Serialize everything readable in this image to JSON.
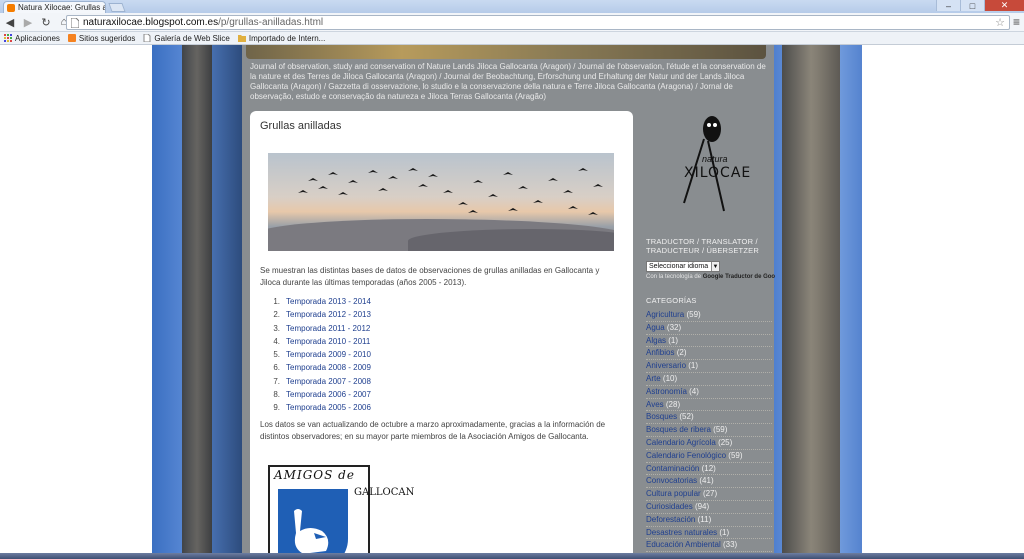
{
  "browser": {
    "tab_title": "Natura Xilocae: Grullas an",
    "tab_close": "×",
    "url_host": "naturaxilocae.blogspot.com.es",
    "url_path": "/p/grullas-anilladas.html",
    "window_controls": [
      "–",
      "□",
      "✕"
    ]
  },
  "bookmarks": [
    {
      "label": "Aplicaciones",
      "icon": "apps-grid-icon",
      "color": "#d44"
    },
    {
      "label": "Sitios sugeridos",
      "icon": "orange-square-icon",
      "color": "#f58220"
    },
    {
      "label": "Galería de Web Slice",
      "icon": "page-icon",
      "color": "#888"
    },
    {
      "label": "Importado de Intern...",
      "icon": "folder-icon",
      "color": "#e0b040"
    }
  ],
  "blog": {
    "description": "Journal of observation, study and conservation of Nature Lands Jiloca Gallocanta (Aragon) / Journal de l'observation, l'étude et la conservation de la nature et des Terres de Jiloca Gallocanta (Aragon) / Journal der Beobachtung, Erforschung und Erhaltung der Natur und der Lands Jiloca Gallocanta (Aragon) / Gazzetta di osservazione, lo studio e la conservazione della natura e Terre Jiloca Gallocanta (Aragona) / Jornal de observação, estudo e conservação da natureza e Jiloca Terras Gallocanta (Aragão)",
    "post_title": "Grullas anilladas",
    "intro": "Se muestran las distintas bases de datos de observaciones de grullas anilladas en Gallocanta y Jiloca durante las últimas temporadas (años 2005 - 2013).",
    "seasons": [
      {
        "num": "1.",
        "label": "Temporada 2013 - 2014"
      },
      {
        "num": "2.",
        "label": "Temporada 2012 - 2013"
      },
      {
        "num": "3.",
        "label": "Temporada 2011 - 2012"
      },
      {
        "num": "4.",
        "label": "Temporada 2010 - 2011"
      },
      {
        "num": "5.",
        "label": "Temporada 2009 - 2010"
      },
      {
        "num": "6.",
        "label": "Temporada 2008 - 2009"
      },
      {
        "num": "7.",
        "label": "Temporada 2007 - 2008"
      },
      {
        "num": "8.",
        "label": "Temporada 2006 - 2007"
      },
      {
        "num": "9.",
        "label": "Temporada 2005 - 2006"
      }
    ],
    "outro": "Los datos se van actualizando de octubre a marzo aproximadamente, gracias a la información de distintos observadores; en su mayor parte miembros de la Asociación Amigos de Gallocanta.",
    "logo_text": "AMIGOS de",
    "logo_side": "GALLOCAN"
  },
  "sidebar": {
    "brand_small": "natura",
    "brand_main": "XILOCAE",
    "translator_heading": "TRADUCTOR / TRANSLATOR / TRADUCTEUR / ÜBERSETZER",
    "language_select": "Seleccionar idioma",
    "powered_by": "Con la tecnología de",
    "powered_brand": "Google",
    "powered_suffix": "Traductor de Goo",
    "categories_heading": "CATEGORÍAS",
    "categories": [
      {
        "name": "Agricultura",
        "count": "(59)"
      },
      {
        "name": "Agua",
        "count": "(32)"
      },
      {
        "name": "Algas",
        "count": "(1)"
      },
      {
        "name": "Anfibios",
        "count": "(2)"
      },
      {
        "name": "Aniversario",
        "count": "(1)"
      },
      {
        "name": "Arte",
        "count": "(10)"
      },
      {
        "name": "Astronomía",
        "count": "(4)"
      },
      {
        "name": "Aves",
        "count": "(28)"
      },
      {
        "name": "Bosques",
        "count": "(52)"
      },
      {
        "name": "Bosques de ribera",
        "count": "(59)"
      },
      {
        "name": "Calendario Agrícola",
        "count": "(25)"
      },
      {
        "name": "Calendario Fenológico",
        "count": "(59)"
      },
      {
        "name": "Contaminación",
        "count": "(12)"
      },
      {
        "name": "Convocatorias",
        "count": "(41)"
      },
      {
        "name": "Cultura popular",
        "count": "(27)"
      },
      {
        "name": "Curiosidades",
        "count": "(94)"
      },
      {
        "name": "Deforestación",
        "count": "(11)"
      },
      {
        "name": "Desastres naturales",
        "count": "(1)"
      },
      {
        "name": "Educación Ambiental",
        "count": "(33)"
      }
    ]
  }
}
